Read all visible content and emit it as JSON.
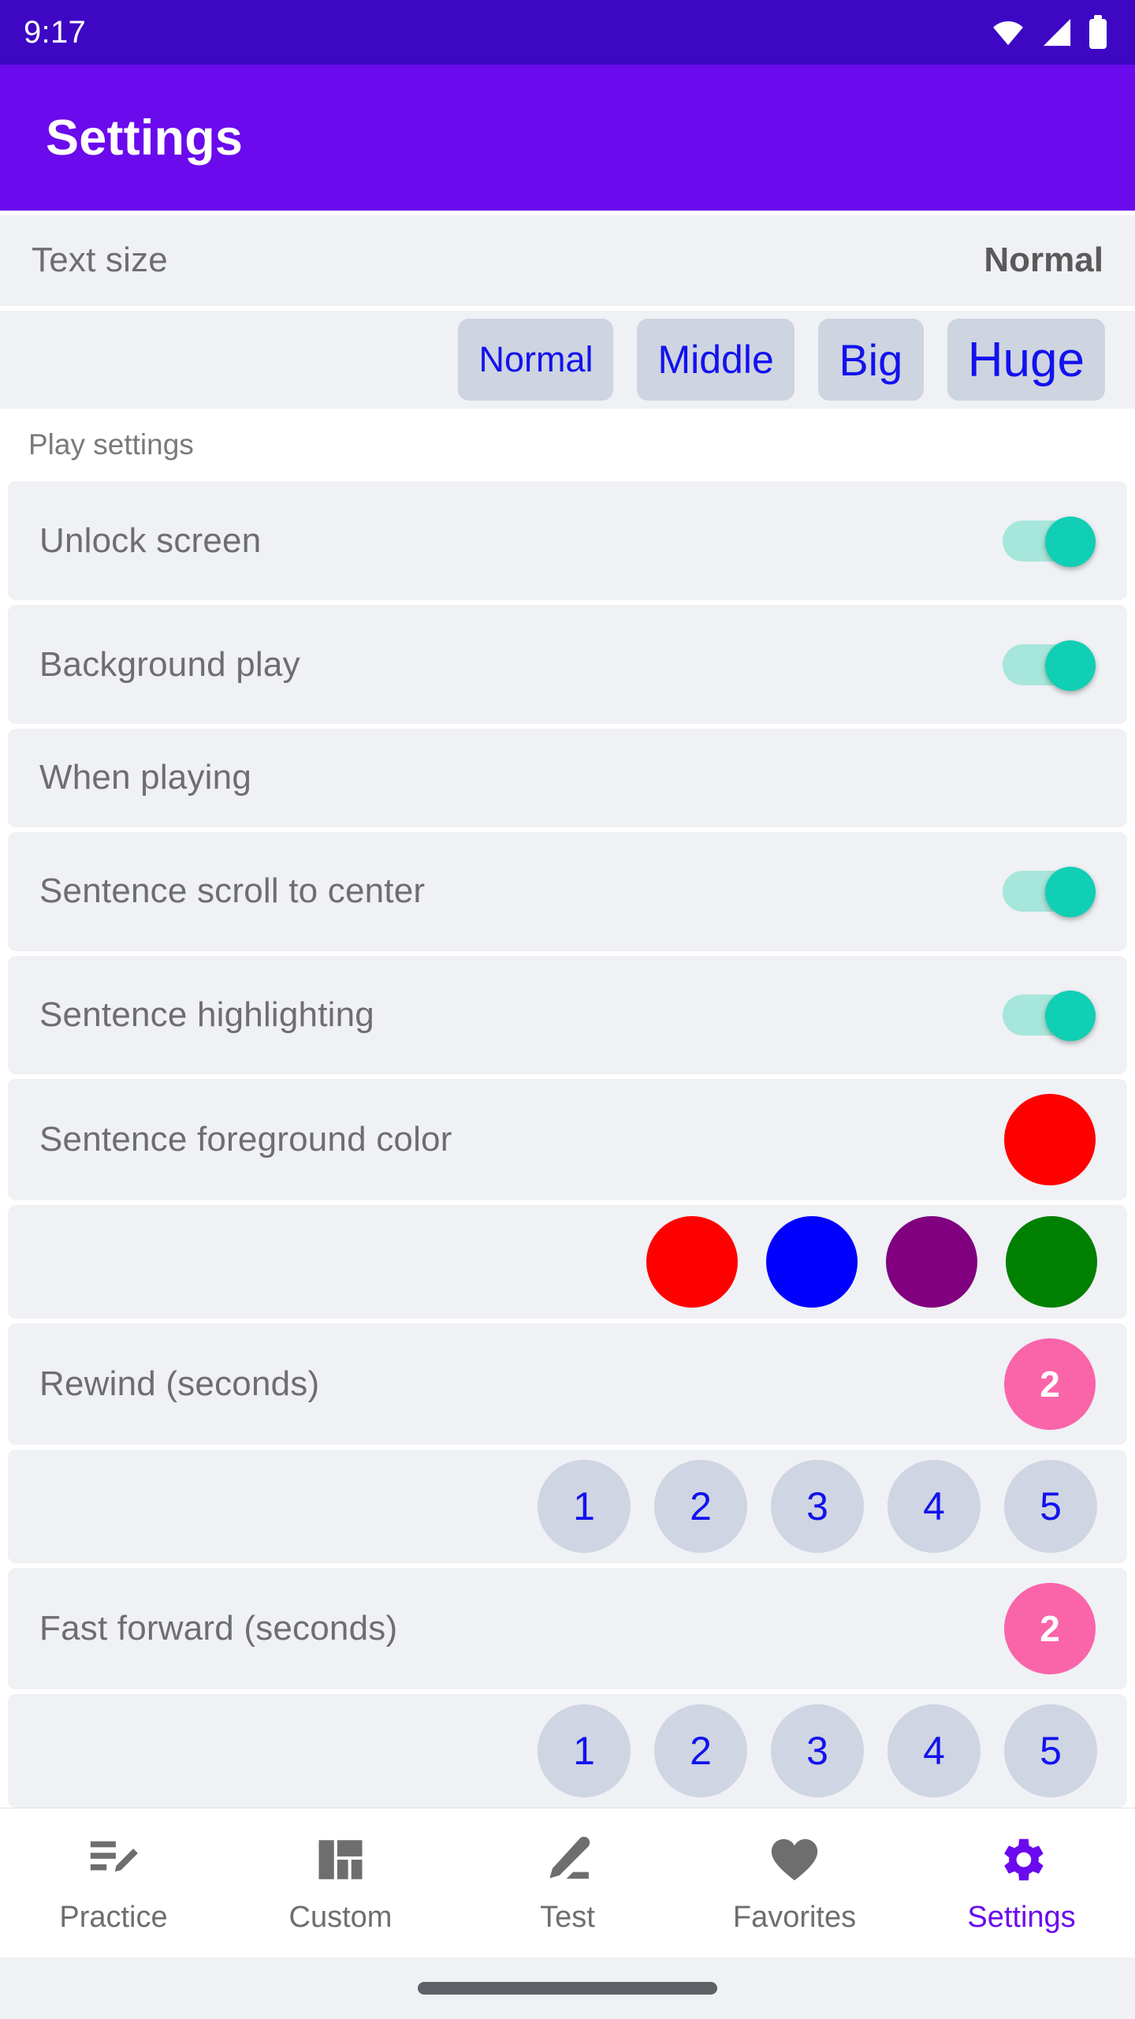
{
  "status_bar": {
    "time": "9:17",
    "icons": [
      "wifi-icon",
      "cellular-signal-icon",
      "battery-full-icon"
    ],
    "background": "#3D07C4"
  },
  "app_bar": {
    "title": "Settings",
    "background": "#6A0AED",
    "text_color": "#FFFFFF"
  },
  "text_size": {
    "label": "Text size",
    "value": "Normal",
    "options": [
      {
        "label": "Normal"
      },
      {
        "label": "Middle"
      },
      {
        "label": "Big"
      },
      {
        "label": "Huge"
      }
    ],
    "chip_background": "#CED4E0",
    "chip_text_color": "#1212EE"
  },
  "play_settings": {
    "header": "Play settings",
    "rows": [
      {
        "label": "Unlock screen",
        "control": "switch",
        "value": "on"
      },
      {
        "label": "Background play",
        "control": "switch",
        "value": "on"
      }
    ]
  },
  "when_playing": {
    "header": "When playing",
    "rows": [
      {
        "label": "Sentence scroll to center",
        "control": "switch",
        "value": "on"
      },
      {
        "label": "Sentence highlighting",
        "control": "switch",
        "value": "on"
      }
    ]
  },
  "sentence_foreground_color": {
    "label": "Sentence foreground color",
    "selected": "#FF0000",
    "options": [
      {
        "name": "red",
        "hex": "#FF0000"
      },
      {
        "name": "blue",
        "hex": "#0000FF"
      },
      {
        "name": "purple",
        "hex": "#800080"
      },
      {
        "name": "green",
        "hex": "#008000"
      }
    ]
  },
  "rewind": {
    "label": "Rewind (seconds)",
    "value": "2",
    "options": [
      "1",
      "2",
      "3",
      "4",
      "5"
    ]
  },
  "fast_forward": {
    "label": "Fast forward (seconds)",
    "value": "2",
    "options": [
      "1",
      "2",
      "3",
      "4",
      "5"
    ]
  },
  "switch_colors": {
    "track_on": "#A7E6DA",
    "thumb_on": "#10CFB4"
  },
  "badge_color": "#FA64A9",
  "bottom_nav": {
    "active": "Settings",
    "items": [
      {
        "label": "Practice",
        "icon": "list-edit-icon"
      },
      {
        "label": "Custom",
        "icon": "dashboard-grid-icon"
      },
      {
        "label": "Test",
        "icon": "pencil-edit-icon"
      },
      {
        "label": "Favorites",
        "icon": "heart-icon"
      },
      {
        "label": "Settings",
        "icon": "gear-icon"
      }
    ],
    "inactive_color": "#6E6E6E",
    "active_color": "#6A0AED"
  }
}
